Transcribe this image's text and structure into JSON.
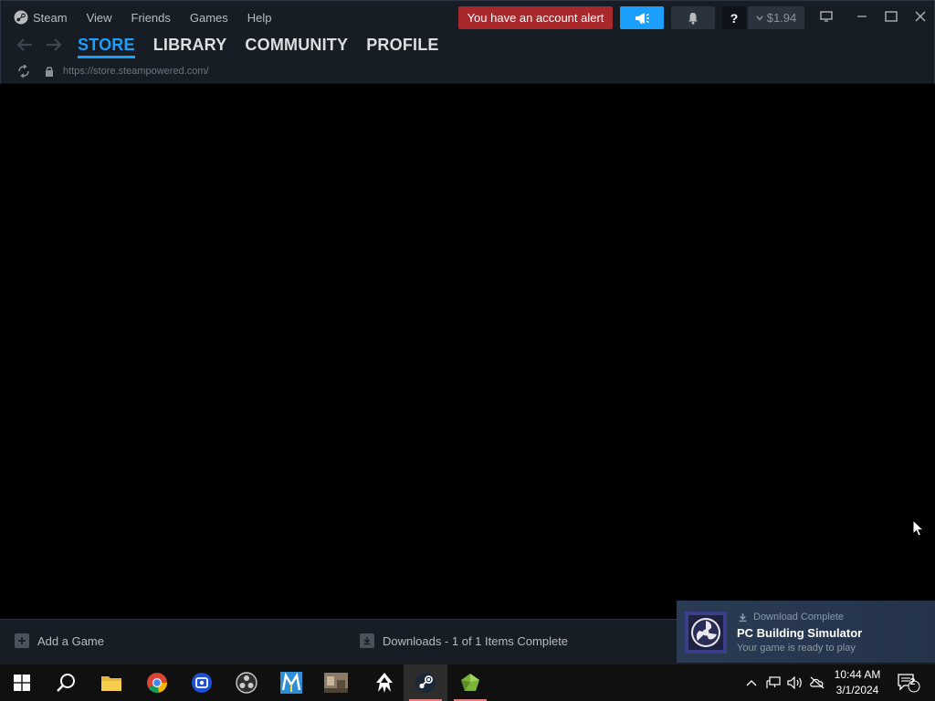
{
  "menubar": {
    "steam": "Steam",
    "view": "View",
    "friends": "Friends",
    "games": "Games",
    "help": "Help"
  },
  "header": {
    "alert": "You have an account alert",
    "help_label": "?",
    "wallet": "$1.94"
  },
  "nav": {
    "tabs": [
      "STORE",
      "LIBRARY",
      "COMMUNITY",
      "PROFILE"
    ],
    "active": "STORE"
  },
  "url": "https://store.steampowered.com/",
  "statusbar": {
    "add_game": "Add a Game",
    "downloads": "Downloads - 1 of 1 Items Complete"
  },
  "toast": {
    "heading": "Download Complete",
    "title": "PC Building Simulator",
    "subtitle": "Your game is ready to play"
  },
  "taskbar": {
    "apps": [
      "start-icon",
      "search-icon",
      "file-explorer-icon",
      "chrome-icon",
      "capture-app-icon",
      "obs-icon",
      "m-app-icon",
      "game-thumbnail-icon",
      "inkscape-like-icon",
      "steam-icon",
      "gem-app-icon"
    ],
    "time": "10:44 AM",
    "date": "3/1/2024",
    "notifications": "2"
  },
  "colors": {
    "accent": "#1a9fff",
    "alert": "#a8282b",
    "chrome_bg": "#171d25"
  }
}
